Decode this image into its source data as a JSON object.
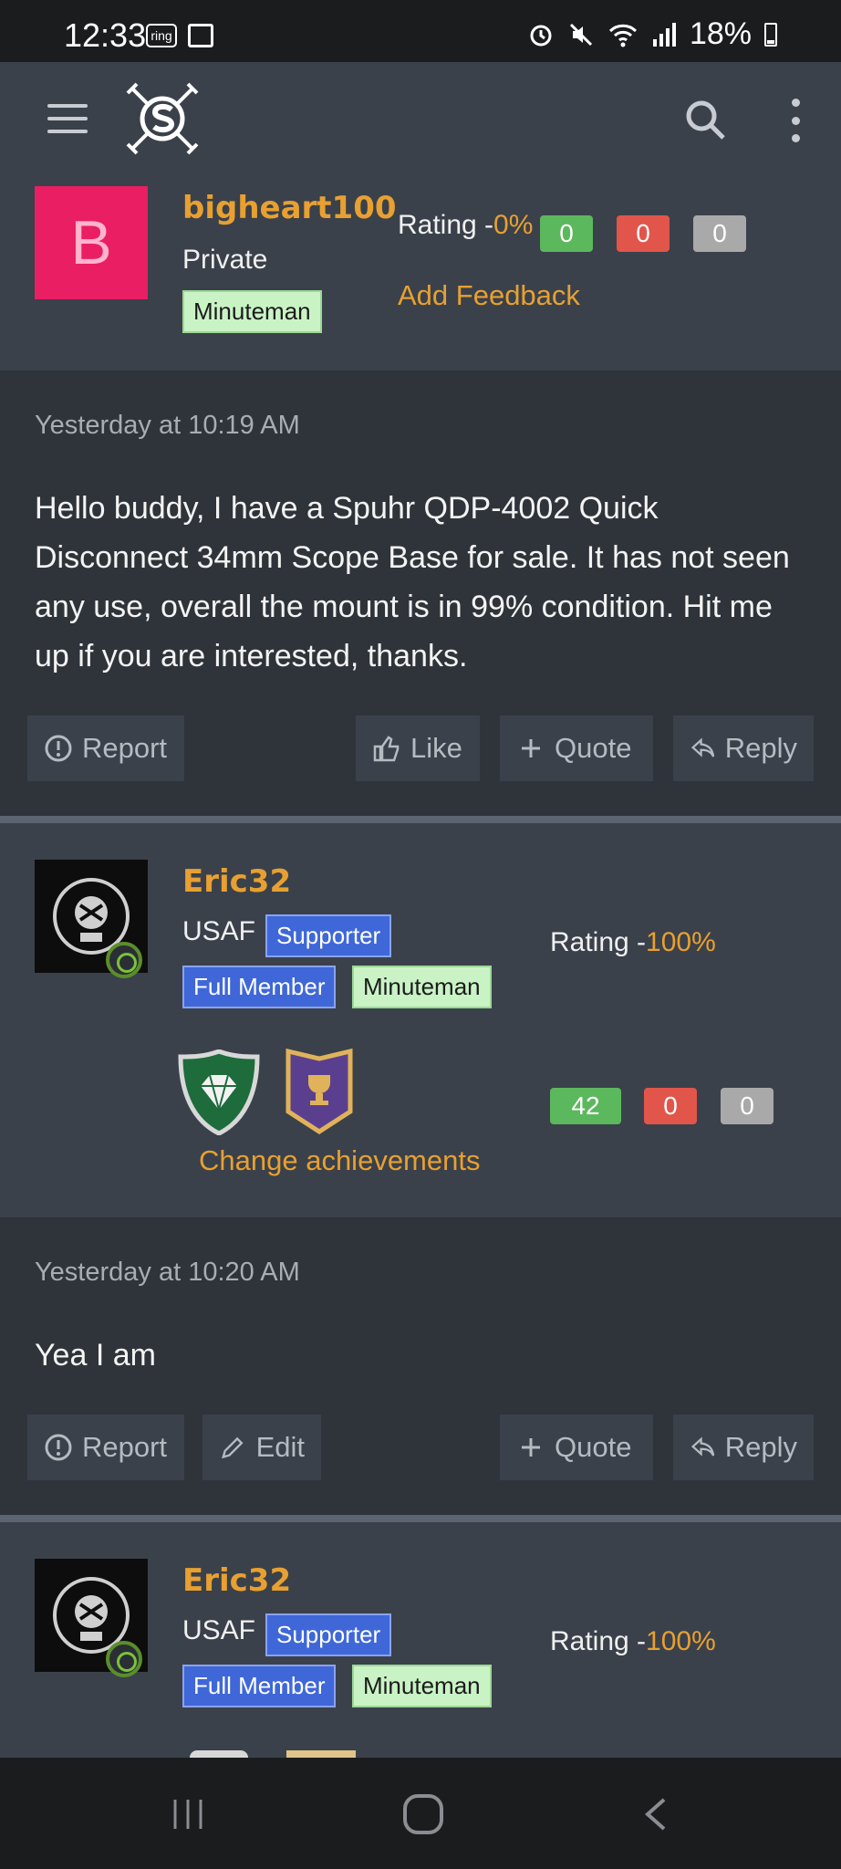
{
  "status_bar": {
    "time": "12:33",
    "ring_label": "ring",
    "battery": "18%"
  },
  "app_bar": {
    "menu_icon": "hamburger-icon",
    "logo_icon": "site-logo",
    "search_icon": "search-icon",
    "more_icon": "more-vertical-icon"
  },
  "post1": {
    "avatar_letter": "B",
    "username": "bigheart100",
    "rank": "Private",
    "badge": "Minuteman",
    "rating_label": "Rating -",
    "rating_pct": "0%",
    "feedback": {
      "positive": "0",
      "negative": "0",
      "neutral": "0"
    },
    "add_feedback": "Add Feedback",
    "timestamp": "Yesterday at 10:19 AM",
    "text": "Hello buddy, I have a Spuhr QDP-4002 Quick Disconnect 34mm Scope Base for sale. It has not seen any use, overall the mount is in 99% condition. Hit me up if you are interested, thanks.",
    "actions": {
      "report": "Report",
      "like": "Like",
      "quote": "Quote",
      "reply": "Reply"
    }
  },
  "post2": {
    "username": "Eric32",
    "rank": "USAF",
    "badges": [
      "Supporter",
      "Full Member",
      "Minuteman"
    ],
    "rating_label": "Rating -",
    "rating_pct": "100%",
    "feedback": {
      "positive": "42",
      "negative": "0",
      "neutral": "0"
    },
    "achievements_link": "Change achievements",
    "timestamp": "Yesterday at 10:20 AM",
    "text": "Yea I am",
    "actions": {
      "report": "Report",
      "edit": "Edit",
      "quote": "Quote",
      "reply": "Reply"
    }
  },
  "post3": {
    "username": "Eric32",
    "rank": "USAF",
    "badges": [
      "Supporter",
      "Full Member",
      "Minuteman"
    ],
    "rating_label": "Rating -",
    "rating_pct": "100%"
  },
  "colors": {
    "accent": "#e8a031",
    "header": "#3a414b",
    "body": "#2f343b",
    "avatar_pink": "#e91e63"
  }
}
